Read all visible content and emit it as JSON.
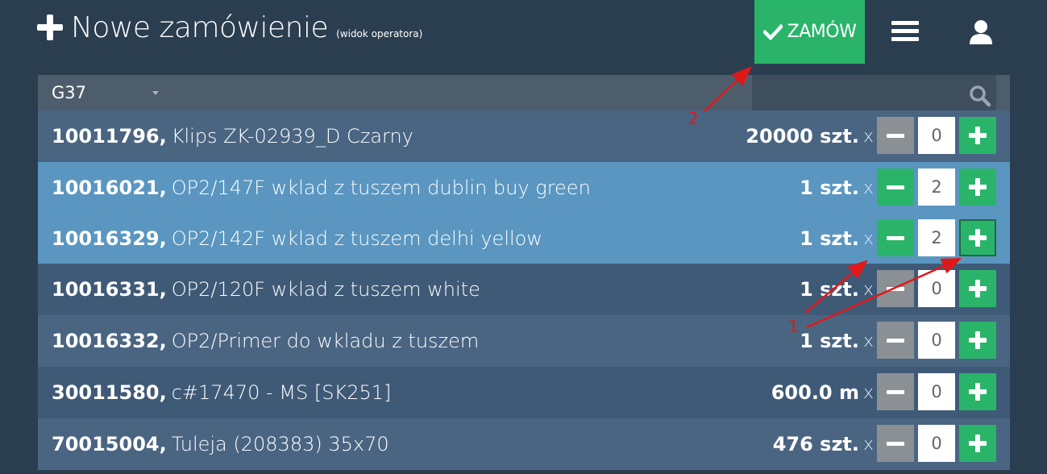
{
  "header": {
    "title": "Nowe zamówienie",
    "subtitle": "(widok operatora)",
    "order_button_label": "ZAMÓW",
    "icons": [
      "plus-icon",
      "check-icon",
      "hamburger-menu-icon",
      "user-icon"
    ]
  },
  "filter": {
    "selected_group": "G37",
    "search_placeholder": ""
  },
  "items": [
    {
      "code": "10011796,",
      "name": "Klips ZK-02939_D Czarny",
      "qty": "20000 szt.",
      "x": "x",
      "count": "0"
    },
    {
      "code": "10016021,",
      "name": "OP2/147F wklad z tuszem dublin buy green",
      "qty": "1 szt.",
      "x": "x",
      "count": "2"
    },
    {
      "code": "10016329,",
      "name": "OP2/142F wklad z tuszem delhi yellow",
      "qty": "1 szt.",
      "x": "x",
      "count": "2"
    },
    {
      "code": "10016331,",
      "name": "OP2/120F wklad z tuszem white",
      "qty": "1 szt.",
      "x": "x",
      "count": "0"
    },
    {
      "code": "10016332,",
      "name": "OP2/Primer do wkladu z tuszem",
      "qty": "1 szt.",
      "x": "x",
      "count": "0"
    },
    {
      "code": "30011580,",
      "name": "c#17470 - MS [SK251]",
      "qty": "600.0 m",
      "x": "x",
      "count": "0"
    },
    {
      "code": "70015004,",
      "name": "Tuleja (208383) 35x70",
      "qty": "476 szt.",
      "x": "x",
      "count": "0"
    }
  ],
  "annotations": {
    "label_1": "1",
    "label_2": "2",
    "color": "#e01818"
  },
  "colors": {
    "background": "#2b3e50",
    "accent_green": "#2ab46a",
    "selected_row": "#5a96c0",
    "disabled_gray": "#8a9094"
  }
}
